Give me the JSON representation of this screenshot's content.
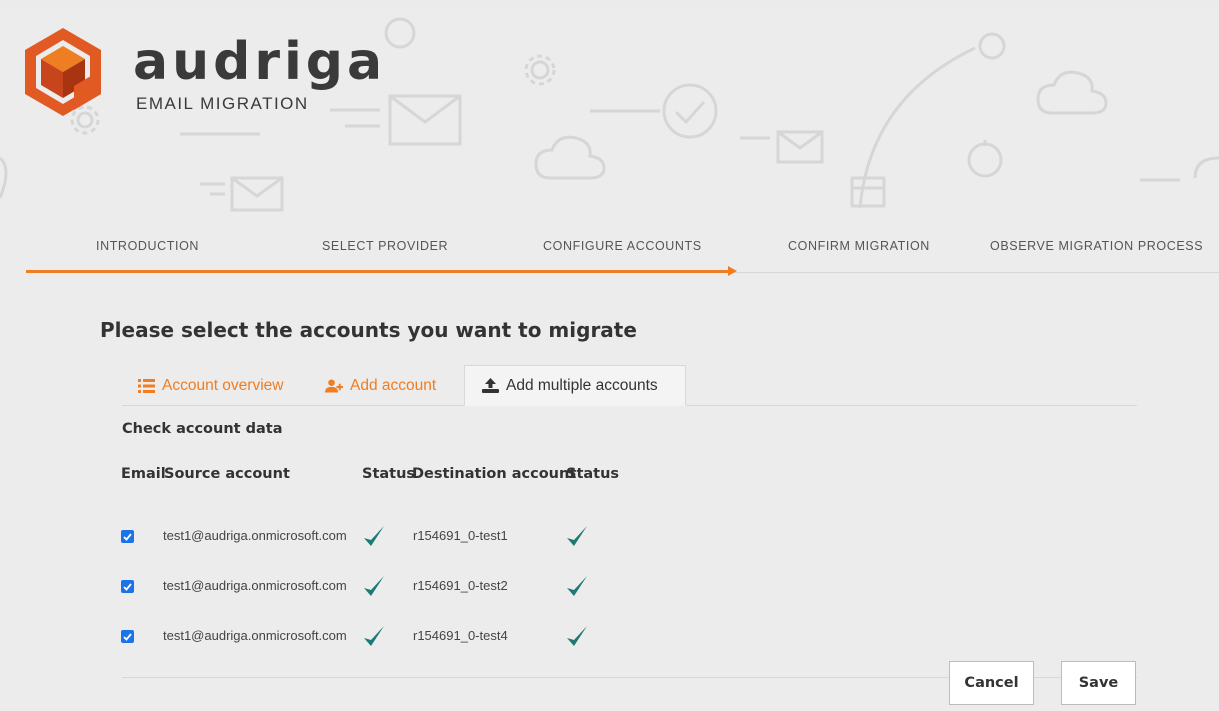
{
  "brand": {
    "name": "audriga",
    "subtitle": "EMAIL MIGRATION"
  },
  "colors": {
    "accent": "#ef7d22",
    "check": "#1d7a74",
    "checkbox": "#1a73e8"
  },
  "steps": [
    {
      "label": "INTRODUCTION"
    },
    {
      "label": "SELECT PROVIDER"
    },
    {
      "label": "CONFIGURE ACCOUNTS"
    },
    {
      "label": "CONFIRM MIGRATION"
    },
    {
      "label": "OBSERVE MIGRATION PROCESS"
    }
  ],
  "main": {
    "title": "Please select the accounts you want to migrate",
    "tabs": [
      {
        "label": "Account overview",
        "icon": "list-icon"
      },
      {
        "label": "Add account",
        "icon": "add-user-icon"
      },
      {
        "label": "Add multiple accounts",
        "icon": "upload-icon"
      }
    ],
    "section_title": "Check account data",
    "columns": {
      "email": "Email",
      "source": "Source account",
      "status": "Status",
      "destination": "Destination account",
      "status2": "Status"
    },
    "rows": [
      {
        "checked": true,
        "source": "test1@audriga.onmicrosoft.com",
        "destination": "r154691_0-test1",
        "source_status": "ok-check-icon",
        "dest_status": "ok-check-icon"
      },
      {
        "checked": true,
        "source": "test1@audriga.onmicrosoft.com",
        "destination": "r154691_0-test2",
        "source_status": "ok-check-icon",
        "dest_status": "ok-check-icon"
      },
      {
        "checked": true,
        "source": "test1@audriga.onmicrosoft.com",
        "destination": "r154691_0-test4",
        "source_status": "ok-check-icon",
        "dest_status": "ok-check-icon"
      }
    ]
  },
  "footer": {
    "cancel_label": "Cancel",
    "save_label": "Save"
  }
}
